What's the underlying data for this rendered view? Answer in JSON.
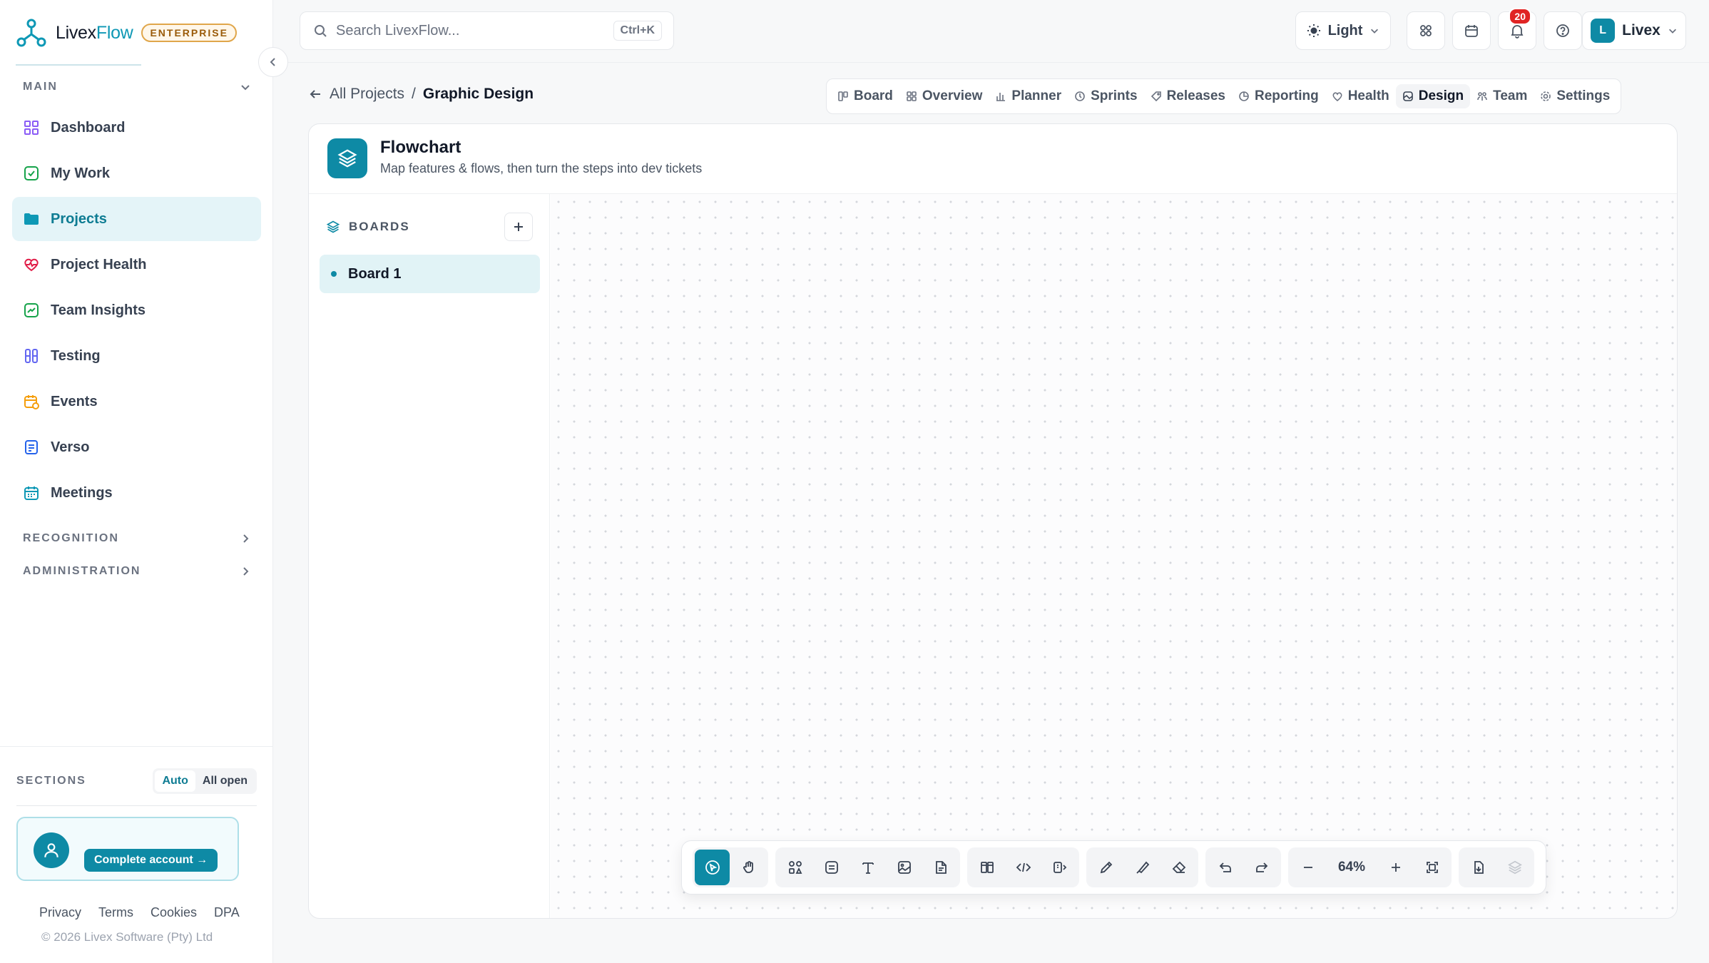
{
  "brand": {
    "name_a": "Livex",
    "name_b": "Flow",
    "tier": "ENTERPRISE"
  },
  "sidebar": {
    "main_label": "MAIN",
    "items": [
      {
        "label": "Dashboard",
        "icon": "dashboard-icon",
        "color": "#8b5cf6"
      },
      {
        "label": "My Work",
        "icon": "check-square-icon",
        "color": "#16a34a"
      },
      {
        "label": "Projects",
        "icon": "folder-icon",
        "color": "#0e98b5"
      },
      {
        "label": "Project Health",
        "icon": "heart-pulse-icon",
        "color": "#e11d48"
      },
      {
        "label": "Team Insights",
        "icon": "trend-icon",
        "color": "#16a34a"
      },
      {
        "label": "Testing",
        "icon": "test-tubes-icon",
        "color": "#6366f1"
      },
      {
        "label": "Events",
        "icon": "calendar-clock-icon",
        "color": "#f59e0b"
      },
      {
        "label": "Verso",
        "icon": "document-icon",
        "color": "#2563eb"
      },
      {
        "label": "Meetings",
        "icon": "calendar-icon",
        "color": "#0e98b5"
      }
    ],
    "recognition_label": "RECOGNITION",
    "administration_label": "ADMINISTRATION",
    "sections_label": "SECTIONS",
    "sections_auto": "Auto",
    "sections_all_open": "All open",
    "complete_account": "Complete account",
    "legal": [
      "Privacy",
      "Terms",
      "Cookies",
      "DPA"
    ],
    "copyright": "© 2026 Livex Software (Pty) Ltd"
  },
  "topbar": {
    "search_placeholder": "Search LivexFlow...",
    "search_shortcut": "Ctrl+K",
    "theme": "Light",
    "notifications_count": "20",
    "user_name": "Livex",
    "user_initial": "L"
  },
  "breadcrumb": {
    "parent": "All Projects",
    "separator": "/",
    "current": "Graphic Design"
  },
  "tabs": [
    {
      "label": "Board",
      "icon": "board-icon"
    },
    {
      "label": "Overview",
      "icon": "grid-icon"
    },
    {
      "label": "Planner",
      "icon": "bar-chart-icon"
    },
    {
      "label": "Sprints",
      "icon": "clock-icon"
    },
    {
      "label": "Releases",
      "icon": "tag-icon"
    },
    {
      "label": "Reporting",
      "icon": "pie-icon"
    },
    {
      "label": "Health",
      "icon": "heart-icon"
    },
    {
      "label": "Design",
      "icon": "palette-icon"
    },
    {
      "label": "Team",
      "icon": "team-icon"
    },
    {
      "label": "Settings",
      "icon": "gear-icon"
    }
  ],
  "active_tab": "Design",
  "flowchart": {
    "title": "Flowchart",
    "subtitle": "Map features & flows, then turn the steps into dev tickets",
    "boards_label": "BOARDS",
    "boards": [
      {
        "label": "Board 1"
      }
    ]
  },
  "toolbar": {
    "zoom": "64%"
  },
  "colors": {
    "accent": "#0e8aa5",
    "badge": "#e02424",
    "enterprise": "#e0a64a"
  }
}
